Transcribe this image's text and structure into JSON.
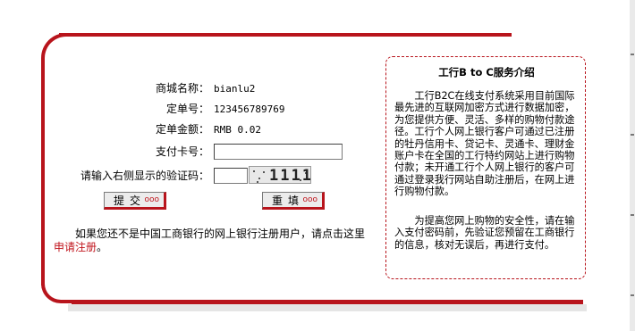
{
  "form": {
    "merchant_label": "商城名称：",
    "merchant_value": "bianlu2",
    "order_label": "定单号：",
    "order_value": "123456789769",
    "amount_label": "定单金额：",
    "amount_value": "RMB 0.02",
    "card_label": "支付卡号：",
    "card_value": "",
    "captcha_label": "请输入右侧显示的验证码：",
    "captcha_value": "",
    "captcha_text": "1111",
    "submit_label": "提交",
    "reset_label": "重填",
    "button_dots": "ooo"
  },
  "register": {
    "text": "如果您还不是中国工商银行的网上银行注册用户，请点击这里",
    "link_text": "申请注册",
    "tail": "。"
  },
  "info": {
    "title": "工行B to C服务介绍",
    "para1": "工行B2C在线支付系统采用目前国际最先进的互联网加密方式进行数据加密，为您提供方便、灵活、多样的购物付款途径。工行个人网上银行客户可通过已注册的牡丹信用卡、贷记卡、灵通卡、理财金账户卡在全国的工行特约网站上进行购物付款；未开通工行个人网上银行的客户可通过登录我行网站自助注册后，在网上进行购物付款。",
    "para2": "为提高您网上购物的安全性，请在输入支付密码前，先验证您预留在工商银行的信息，核对无误后，再进行支付。"
  },
  "colors": {
    "brand_red": "#b8141c",
    "link_red": "#c0141c"
  }
}
